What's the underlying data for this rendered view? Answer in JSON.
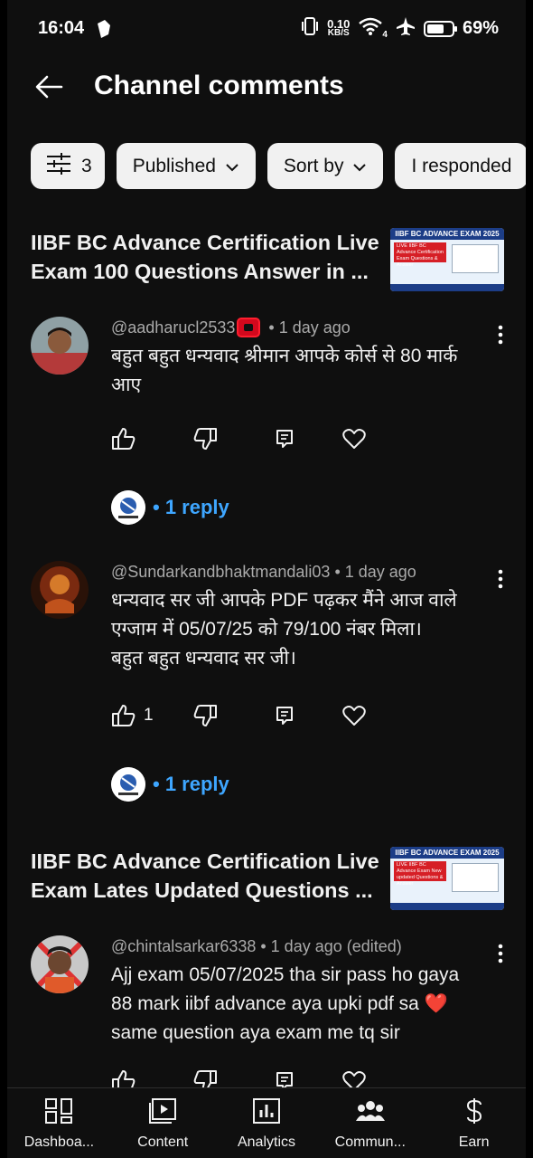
{
  "status_bar": {
    "time": "16:04",
    "net_speed_value": "0.10",
    "net_speed_unit": "KB/S",
    "network_type": "4",
    "battery_percent": "69%",
    "battery_level": 0.69
  },
  "header": {
    "title": "Channel comments"
  },
  "filters": {
    "filter_count": "3",
    "chips": [
      "Published",
      "Sort by",
      "I responded"
    ]
  },
  "groups": [
    {
      "video_title": "IIBF BC Advance Certification Live\nExam 100 Questions Answer in ...",
      "thumbnail_heading": "IIBF BC ADVANCE EXAM 2025",
      "thumbnail_subtitle": "LIVE IIBF BC Advance Certification Exam Questions & Answer",
      "comments": [
        {
          "author": "@aadharucl2533",
          "time": "1 day ago",
          "text": "बहुत बहुत धन्यवाद श्रीमान आपके कोर्स से 80 मार्क\nआए",
          "likes": "",
          "reply_label": "1 reply"
        },
        {
          "author": "@Sundarkandbhaktmandali03",
          "time": "1 day ago",
          "text": "धन्यवाद सर जी आपके PDF पढ़कर मैंने आज वाले\nएग्जाम में 05/07/25 को 79/100 नंबर मिला।\nबहुत बहुत धन्यवाद सर जी।",
          "likes": "1",
          "reply_label": "1 reply"
        }
      ]
    },
    {
      "video_title": "IIBF BC Advance Certification Live\nExam Lates Updated Questions ...",
      "thumbnail_heading": "IIBF BC ADVANCE EXAM 2025",
      "thumbnail_subtitle": "LIVE IIBF BC Advance Exam New updated Questions & Answer",
      "comments": [
        {
          "author": "@chintalsarkar6338",
          "time": "1 day ago (edited)",
          "text": "Ajj exam 05/07/2025 tha sir pass ho gaya\n88 mark iibf advance aya upki pdf sa ❤️\nsame question aya exam me tq sir",
          "likes": ""
        }
      ]
    }
  ],
  "bottom_nav": [
    {
      "label": "Dashboa...",
      "icon": "dashboard-icon"
    },
    {
      "label": "Content",
      "icon": "content-icon"
    },
    {
      "label": "Analytics",
      "icon": "analytics-icon"
    },
    {
      "label": "Commun...",
      "icon": "community-icon"
    },
    {
      "label": "Earn",
      "icon": "earn-icon"
    }
  ],
  "colors": {
    "background": "#0f0f0f",
    "link": "#3ea6ff",
    "chip_bg": "#f1f1f1",
    "badge_red": "#d4081d"
  }
}
